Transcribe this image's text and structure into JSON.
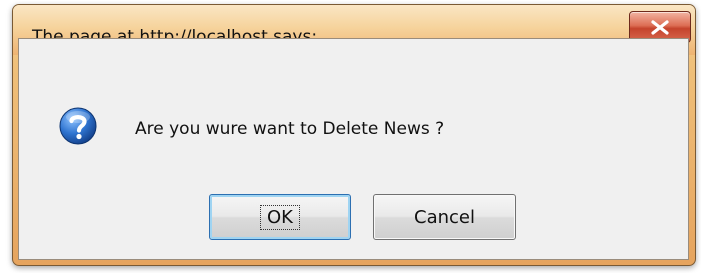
{
  "dialog": {
    "title": "The page at http://localhost says:",
    "close_icon": "close-x-icon",
    "message_icon": "question-icon",
    "message": "Are you wure want to Delete News ?",
    "ok_label": "OK",
    "cancel_label": "Cancel",
    "colors": {
      "title_bar": "#efc07a",
      "close_button": "#c5432c",
      "question_icon": "#1f5fb5",
      "content_bg": "#f0f0f0",
      "ok_focus_border": "#2c6fb1"
    }
  }
}
